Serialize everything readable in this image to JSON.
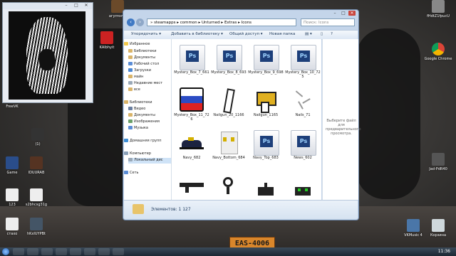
{
  "explorer": {
    "breadcrumb": [
      "steamapps",
      "common",
      "Unturned",
      "Extras",
      "Icons"
    ],
    "search_placeholder": "Поиск: Icons",
    "toolbar": {
      "organize": "Упорядочить ▾",
      "add_to_library": "Добавить в библиотеку ▾",
      "share": "Общий доступ ▾",
      "new_folder": "Новая папка"
    },
    "nav": {
      "favorites": {
        "label": "Избранное",
        "items": [
          "Библиотеки",
          "Документы",
          "Рабочий стол",
          "Загрузки",
          "майн",
          "Недавние мест",
          "все"
        ]
      },
      "libraries": {
        "label": "Библиотеки",
        "items": [
          "Видео",
          "Документы",
          "Изображения",
          "Музыка"
        ]
      },
      "homegroup": "Домашняя групп",
      "computer": {
        "label": "Компьютер",
        "items": [
          "Локальный дис"
        ]
      },
      "network": "Сеть"
    },
    "files": [
      {
        "name": "Mystery_Box_7_661",
        "type": "ps"
      },
      {
        "name": "Mystery_Box_8_693",
        "type": "ps"
      },
      {
        "name": "Mystery_Box_9_698",
        "type": "ps"
      },
      {
        "name": "Mystery_Box_10_725",
        "type": "ps"
      },
      {
        "name": "Mystery_Box_11_726",
        "type": "box"
      },
      {
        "name": "Nailgun_20_1166",
        "type": "nailgun"
      },
      {
        "name": "Nailgun_1165",
        "type": "nailgun2"
      },
      {
        "name": "Nails_71",
        "type": "nails"
      },
      {
        "name": "Navy_682",
        "type": "hat"
      },
      {
        "name": "Navy_Bottom_684",
        "type": "pants"
      },
      {
        "name": "Navy_Top_683",
        "type": "ps"
      },
      {
        "name": "News_602",
        "type": "ps"
      },
      {
        "name": "",
        "type": "gun"
      },
      {
        "name": "",
        "type": "camera"
      },
      {
        "name": "",
        "type": "device"
      },
      {
        "name": "",
        "type": "device2"
      }
    ],
    "preview_hint": "Выберите файл для предварительного просмотра.",
    "status": "Элементов: 1 127"
  },
  "desktop_icons": {
    "top_left": "агупчнчи",
    "top_right": "fHdtZ1fpucU",
    "window_label": "FreeVK",
    "left_items": [
      "KAlbhyit",
      "(1)",
      "Game",
      "IDUURAB",
      "123",
      "s2bhcsg31g",
      "стахо",
      "hKxIUYPBt"
    ],
    "right_items": [
      "Google Chrome",
      "Jad-PdR40",
      "VKMusic 4",
      "Корзина"
    ]
  },
  "plate": "EAS-4006",
  "taskbar": {
    "clock": "11:36"
  },
  "colors": {
    "ps_dark": "#1d3f7a",
    "ps_light": "#9fd3ff",
    "taskbar": "#1c2733"
  }
}
